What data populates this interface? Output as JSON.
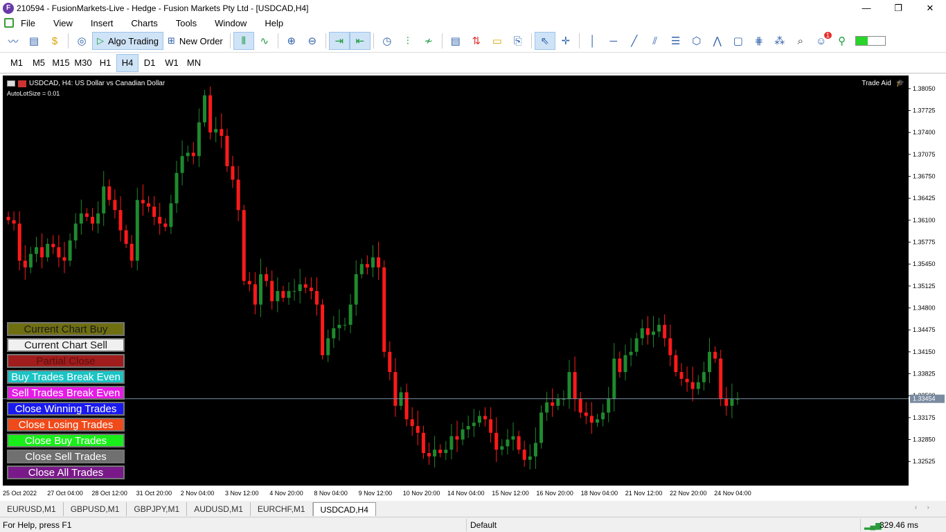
{
  "titlebar": {
    "title": "210594 - FusionMarkets-Live - Hedge - Fusion Markets Pty Ltd - [USDCAD,H4]",
    "icon_letter": "F",
    "minimize": "—",
    "restore": "❐",
    "close": "✕"
  },
  "menu": [
    "File",
    "View",
    "Insert",
    "Charts",
    "Tools",
    "Window",
    "Help"
  ],
  "toolbar": {
    "algo_trading": "Algo Trading",
    "new_order": "New Order",
    "notification_count": "1"
  },
  "timeframes": [
    "M1",
    "M5",
    "M15",
    "M30",
    "H1",
    "H4",
    "D1",
    "W1",
    "MN"
  ],
  "active_timeframe": "H4",
  "chart": {
    "symbol_title": "USDCAD, H4:  US Dollar vs Canadian Dollar",
    "autolot": "AutoLotSize = 0.01",
    "trade_aid": "Trade Aid",
    "current_price": "1.33454",
    "price_ticks": [
      "1.38050",
      "1.37725",
      "1.37400",
      "1.37075",
      "1.36750",
      "1.36425",
      "1.36100",
      "1.35775",
      "1.35450",
      "1.35125",
      "1.34800",
      "1.34475",
      "1.34150",
      "1.33825",
      "1.33500",
      "1.33175",
      "1.32850",
      "1.32525"
    ],
    "time_ticks": [
      "25 Oct 2022",
      "27 Oct 04:00",
      "28 Oct 12:00",
      "31 Oct 20:00",
      "2 Nov 04:00",
      "3 Nov 12:00",
      "4 Nov 20:00",
      "8 Nov 04:00",
      "9 Nov 12:00",
      "10 Nov 20:00",
      "14 Nov 04:00",
      "15 Nov 12:00",
      "16 Nov 20:00",
      "18 Nov 04:00",
      "21 Nov 12:00",
      "22 Nov 20:00",
      "24 Nov 04:00"
    ],
    "colors": {
      "bull": "#1e8a2e",
      "bear": "#ff1a1a",
      "background": "#000000",
      "price_line": "#7a8aa0"
    }
  },
  "chart_data": {
    "type": "candlestick",
    "ylim": [
      1.3225,
      1.381
    ],
    "candles_close_approx": [
      1.361,
      1.3605,
      1.355,
      1.354,
      1.356,
      1.357,
      1.3555,
      1.3575,
      1.357,
      1.3555,
      1.355,
      1.358,
      1.3605,
      1.362,
      1.3615,
      1.3605,
      1.362,
      1.366,
      1.364,
      1.3625,
      1.3595,
      1.3575,
      1.355,
      1.364,
      1.3635,
      1.363,
      1.3615,
      1.3605,
      1.36,
      1.3635,
      1.368,
      1.3705,
      1.371,
      1.3705,
      1.3755,
      1.3795,
      1.374,
      1.3745,
      1.3735,
      1.369,
      1.367,
      1.3625,
      1.352,
      1.3515,
      1.3485,
      1.353,
      1.352,
      1.349,
      1.3505,
      1.3495,
      1.3505,
      1.3505,
      1.3515,
      1.351,
      1.3505,
      1.3485,
      1.341,
      1.3435,
      1.345,
      1.3455,
      1.3455,
      1.3485,
      1.353,
      1.3545,
      1.354,
      1.3555,
      1.354,
      1.3415,
      1.3385,
      1.3335,
      1.3355,
      1.3315,
      1.3305,
      1.3295,
      1.3265,
      1.326,
      1.327,
      1.3265,
      1.327,
      1.329,
      1.3285,
      1.33,
      1.3305,
      1.331,
      1.332,
      1.3315,
      1.3295,
      1.327,
      1.3275,
      1.3285,
      1.329,
      1.327,
      1.3255,
      1.326,
      1.328,
      1.3325,
      1.334,
      1.3335,
      1.3345,
      1.3345,
      1.3385,
      1.3345,
      1.3325,
      1.332,
      1.331,
      1.3315,
      1.3325,
      1.3345,
      1.3405,
      1.3385,
      1.341,
      1.3415,
      1.3435,
      1.345,
      1.344,
      1.3445,
      1.3455,
      1.3435,
      1.341,
      1.3385,
      1.3375,
      1.337,
      1.336,
      1.337,
      1.3385,
      1.3415,
      1.3405,
      1.3345,
      1.3335,
      1.3345,
      1.3345
    ]
  },
  "trade_buttons": [
    {
      "label": "Current Chart Buy",
      "bg": "#6f6f12",
      "fg": "#1a1a1a"
    },
    {
      "label": "Current Chart Sell",
      "bg": "#f0f0f0",
      "fg": "#1a1a1a"
    },
    {
      "label": "Partial Close",
      "bg": "#a11c1c",
      "fg": "#5a1010"
    },
    {
      "label": "Buy Trades Break Even",
      "bg": "#1ac4c4",
      "fg": "#ffffff"
    },
    {
      "label": "Sell Trades Break Even",
      "bg": "#e61ae6",
      "fg": "#ffffff"
    },
    {
      "label": "Close Winning Trades",
      "bg": "#1a1af0",
      "fg": "#ffffff"
    },
    {
      "label": "Close Losing Trades",
      "bg": "#f04a1a",
      "fg": "#ffffff"
    },
    {
      "label": "Close Buy Trades",
      "bg": "#1aee1a",
      "fg": "#ffffff"
    },
    {
      "label": "Close Sell Trades",
      "bg": "#707070",
      "fg": "#ffffff"
    },
    {
      "label": "Close All Trades",
      "bg": "#7a1a8a",
      "fg": "#ffffff"
    }
  ],
  "tabs": [
    "EURUSD,M1",
    "GBPUSD,M1",
    "GBPJPY,M1",
    "AUDUSD,M1",
    "EURCHF,M1",
    "USDCAD,H4"
  ],
  "active_tab": "USDCAD,H4",
  "status": {
    "help": "For Help, press F1",
    "profile": "Default",
    "ping": "329.46 ms"
  }
}
